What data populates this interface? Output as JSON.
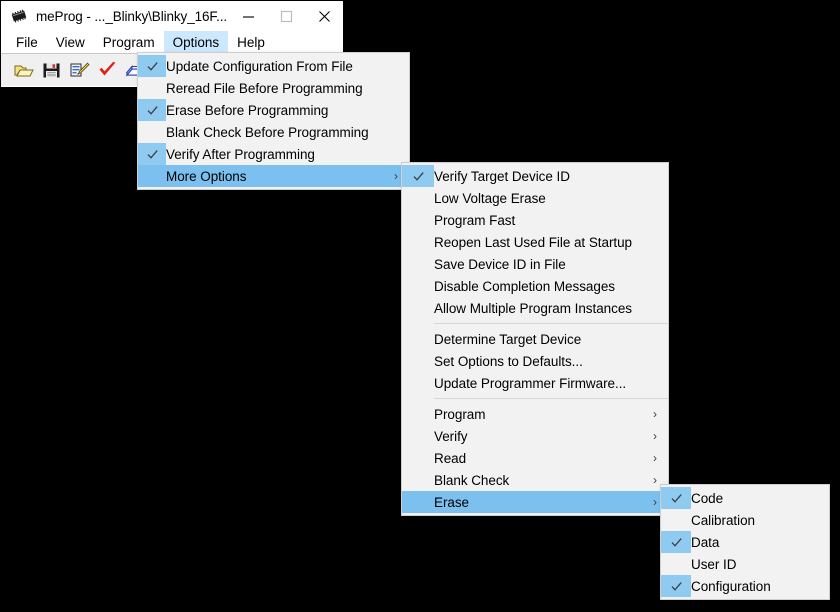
{
  "window": {
    "title": "meProg - ..._Blinky\\Blinky_16F...",
    "icon": "chip-icon",
    "buttons": [
      {
        "name": "minimize-button",
        "glyph": "—",
        "disabled": false
      },
      {
        "name": "maximize-button",
        "glyph": "☐",
        "disabled": true
      },
      {
        "name": "close-button",
        "glyph": "✕",
        "disabled": false
      }
    ]
  },
  "menubar": {
    "items": [
      {
        "label": "File",
        "active": false
      },
      {
        "label": "View",
        "active": false
      },
      {
        "label": "Program",
        "active": false
      },
      {
        "label": "Options",
        "active": true
      },
      {
        "label": "Help",
        "active": false
      }
    ]
  },
  "toolbar": {
    "icons": [
      {
        "name": "open-file-icon",
        "title": "Open"
      },
      {
        "name": "save-file-icon",
        "title": "Save"
      },
      {
        "name": "program-device-icon",
        "title": "Program"
      },
      {
        "name": "verify-check-icon",
        "title": "Verify"
      },
      {
        "name": "erase-icon",
        "title": "Erase"
      },
      {
        "name": "blank-check-bulb-icon",
        "title": "Blank Check"
      }
    ]
  },
  "options_menu": {
    "items": [
      {
        "label": "Update Configuration From File",
        "checked": true,
        "highlighted": false,
        "submenu": false
      },
      {
        "label": "Reread File Before Programming",
        "checked": false,
        "highlighted": false,
        "submenu": false
      },
      {
        "label": "Erase Before Programming",
        "checked": true,
        "highlighted": false,
        "submenu": false
      },
      {
        "label": "Blank Check Before Programming",
        "checked": false,
        "highlighted": false,
        "submenu": false
      },
      {
        "label": "Verify After Programming",
        "checked": true,
        "highlighted": false,
        "submenu": false
      },
      {
        "label": "More Options",
        "checked": false,
        "highlighted": true,
        "submenu": true
      }
    ]
  },
  "more_options_menu": {
    "items": [
      {
        "label": "Verify Target Device ID",
        "checked": true,
        "highlighted": false,
        "submenu": false
      },
      {
        "label": "Low Voltage Erase",
        "checked": false,
        "highlighted": false,
        "submenu": false
      },
      {
        "label": "Program Fast",
        "checked": false,
        "highlighted": false,
        "submenu": false
      },
      {
        "label": "Reopen Last Used File at Startup",
        "checked": false,
        "highlighted": false,
        "submenu": false
      },
      {
        "label": "Save Device ID in File",
        "checked": false,
        "highlighted": false,
        "submenu": false
      },
      {
        "label": "Disable Completion Messages",
        "checked": false,
        "highlighted": false,
        "submenu": false
      },
      {
        "label": "Allow Multiple Program Instances",
        "checked": false,
        "highlighted": false,
        "submenu": false
      },
      {
        "separator": true
      },
      {
        "label": "Determine Target Device",
        "checked": false,
        "highlighted": false,
        "submenu": false
      },
      {
        "label": "Set Options to Defaults...",
        "checked": false,
        "highlighted": false,
        "submenu": false
      },
      {
        "label": "Update Programmer Firmware...",
        "checked": false,
        "highlighted": false,
        "submenu": false
      },
      {
        "separator": true
      },
      {
        "label": "Program",
        "checked": false,
        "highlighted": false,
        "submenu": true
      },
      {
        "label": "Verify",
        "checked": false,
        "highlighted": false,
        "submenu": true
      },
      {
        "label": "Read",
        "checked": false,
        "highlighted": false,
        "submenu": true
      },
      {
        "label": "Blank Check",
        "checked": false,
        "highlighted": false,
        "submenu": true
      },
      {
        "label": "Erase",
        "checked": false,
        "highlighted": true,
        "submenu": true
      }
    ]
  },
  "erase_menu": {
    "items": [
      {
        "label": "Code",
        "checked": true,
        "highlighted": false,
        "submenu": false
      },
      {
        "label": "Calibration",
        "checked": false,
        "highlighted": false,
        "submenu": false
      },
      {
        "label": "Data",
        "checked": true,
        "highlighted": false,
        "submenu": false
      },
      {
        "label": "User ID",
        "checked": false,
        "highlighted": false,
        "submenu": false
      },
      {
        "label": "Configuration",
        "checked": true,
        "highlighted": false,
        "submenu": false
      }
    ]
  },
  "colors": {
    "menu_background": "#f2f2f2",
    "highlight": "#7cc0ef",
    "check_column": "#8fcbf0",
    "menubar_active": "#cce8ff",
    "toolbar_background": "#f0f0f0",
    "desktop": "#000000"
  },
  "submenu_arrow_glyph": "›"
}
